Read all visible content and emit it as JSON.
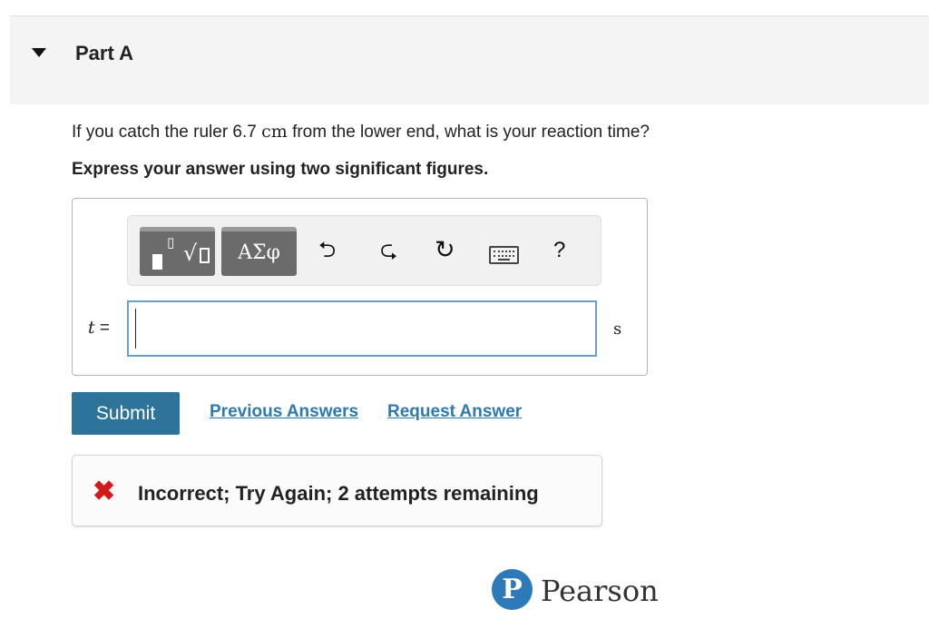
{
  "part": {
    "title": "Part A"
  },
  "question": {
    "text_before": "If you catch the ruler 6.7 ",
    "unit": "cm",
    "text_after": " from the lower end, what is your reaction time?",
    "instruction": "Express your answer using two significant figures."
  },
  "toolbar": {
    "greek_label": "ΑΣφ",
    "icons": [
      "templates-icon",
      "greek-symbols-icon",
      "undo-icon",
      "redo-icon",
      "reset-icon",
      "keyboard-icon",
      "help-icon"
    ],
    "undo_glyph": "⮌",
    "redo_glyph": "⮎",
    "reset_glyph": "↻",
    "help_glyph": "?"
  },
  "answer": {
    "variable": "t",
    "equals": " =",
    "value": "",
    "unit": "s"
  },
  "actions": {
    "submit_label": "Submit",
    "previous_answers_label": "Previous Answers",
    "request_answer_label": "Request Answer"
  },
  "feedback": {
    "icon": "x-icon",
    "status_color": "#d21a1a",
    "message": "Incorrect; Try Again; 2 attempts remaining"
  },
  "brand": {
    "logo_letter": "P",
    "name": "Pearson",
    "color": "#2e7ab8"
  }
}
